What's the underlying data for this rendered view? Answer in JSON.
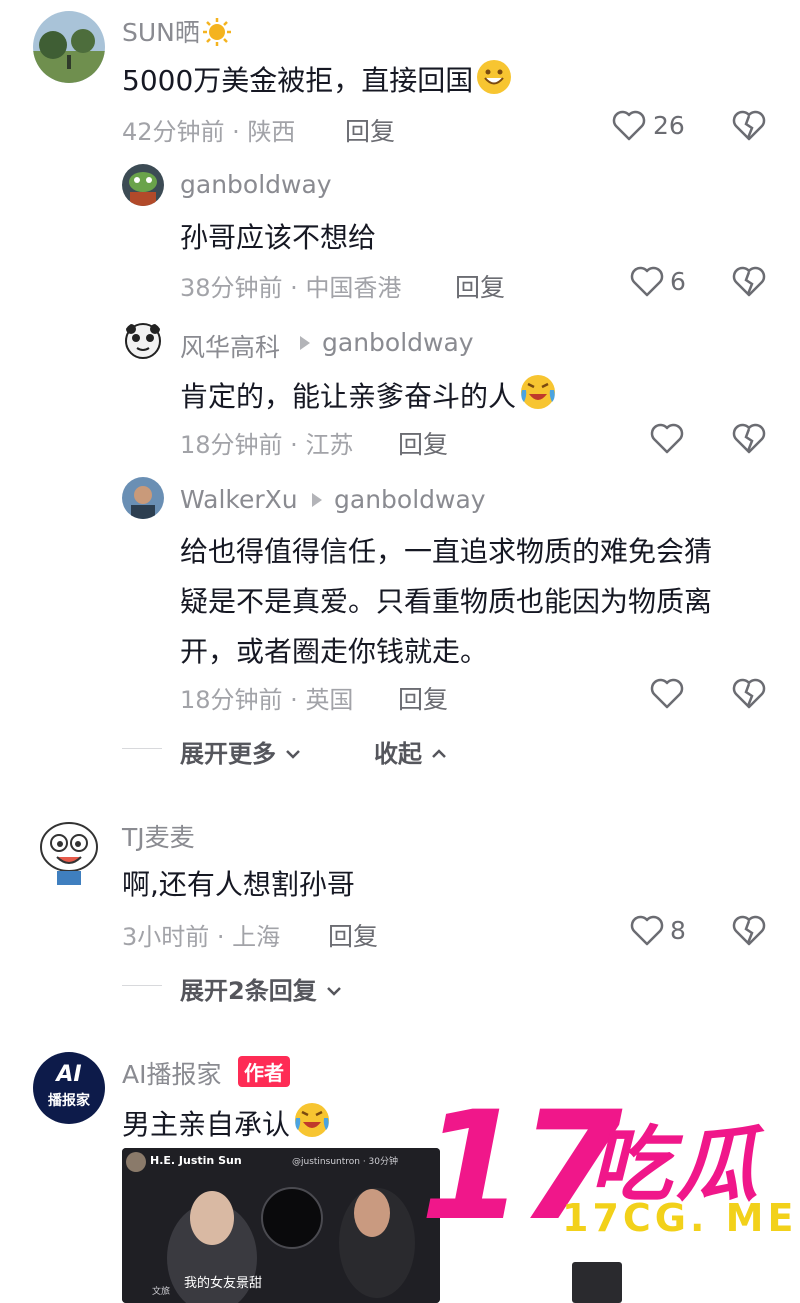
{
  "comments": [
    {
      "username": "SUN晒",
      "text": "5000万美金被拒，直接回国",
      "time": "42分钟前",
      "location": "陕西",
      "reply_label": "回复",
      "likes": "26",
      "replies": [
        {
          "username": "ganboldway",
          "reply_to": "",
          "text": "孙哥应该不想给",
          "time": "38分钟前",
          "location": "中国香港",
          "reply_label": "回复",
          "likes": "6"
        },
        {
          "username": "风华高科",
          "reply_to": "ganboldway",
          "text": "肯定的，能让亲爹奋斗的人",
          "time": "18分钟前",
          "location": "江苏",
          "reply_label": "回复",
          "likes": ""
        },
        {
          "username": "WalkerXu",
          "reply_to": "ganboldway",
          "text_lines": [
            "给也得值得信任，一直追求物质的难免会猜",
            "疑是不是真爱。只看重物质也能因为物质离",
            "开，或者圈走你钱就走。"
          ],
          "time": "18分钟前",
          "location": "英国",
          "reply_label": "回复",
          "likes": ""
        }
      ],
      "expand_more": "展开更多",
      "collapse": "收起"
    },
    {
      "username": "TJ麦麦",
      "text": "啊,还有人想割孙哥",
      "time": "3小时前",
      "location": "上海",
      "reply_label": "回复",
      "likes": "8",
      "expand_replies": "展开2条回复"
    },
    {
      "username": "AI播报家",
      "author_badge": "作者",
      "text": "男主亲自承认",
      "avatar_text_top": "AI",
      "avatar_text_bottom": "播报家",
      "preview": {
        "name": "H.E. Justin Sun",
        "handle": "@justinsuntron · 30分钟",
        "caption": "我的女友景甜",
        "tag": "文旅"
      }
    }
  ],
  "watermark": {
    "number": "17",
    "cn": "吃瓜",
    "domain": "17CG. ME"
  },
  "colors": {
    "accent": "#fe2c55",
    "watermark_pink": "#f0178a",
    "watermark_yellow": "#f2d11a",
    "meta": "#a2a3a8"
  }
}
